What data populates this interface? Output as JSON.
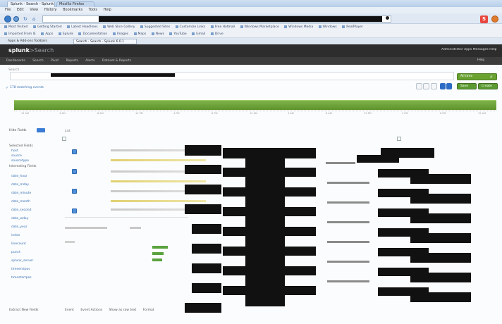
{
  "browser": {
    "tabs": [
      {
        "label": "Splunk - Search - Splunk 6.0.1"
      },
      {
        "label": "Mozilla Firefox"
      }
    ],
    "menu": [
      "File",
      "Edit",
      "View",
      "History",
      "Bookmarks",
      "Tools",
      "Help"
    ],
    "bookmarks_row1": [
      "Most Visited",
      "Getting Started",
      "Latest Headlines",
      "Web Slice Gallery",
      "Suggested Sites",
      "Customize Links",
      "Free Hotmail",
      "Windows Marketplace",
      "Windows Media",
      "Windows",
      "RealPlayer"
    ],
    "bookmarks_row2": [
      "Imported From IE",
      "Apps",
      "Splunk",
      "Documentation",
      "Images",
      "Maps",
      "News",
      "YouTube",
      "Gmail",
      "Drive"
    ],
    "app_tabs": [
      {
        "label": "Apps & Add-ons Toolbars"
      },
      {
        "label": "Search - Search - Splunk 6.0.1"
      }
    ],
    "brand_badge": "S",
    "colors": {
      "chrome": "#cfe0f3",
      "accent": "#3b7dc9"
    }
  },
  "splunk": {
    "logo_main": "splunk",
    "logo_sub": ">Search",
    "account_links": [
      "Administrator",
      "Apps",
      "Messages",
      "Help"
    ],
    "nav": [
      "Dashboards",
      "Search",
      "Pivot",
      "Reports",
      "Alerts",
      "Dataset & Reports"
    ],
    "help_link": "Help",
    "breadcrumb": "Search",
    "search_button": "All time",
    "events_count": "178 matching events",
    "save_button": "Save",
    "create_button": "Create",
    "timeline_ticks": [
      "12 AM",
      "4 AM",
      "8 AM",
      "12 PM",
      "4 PM",
      "8 PM",
      "12 AM",
      "4 AM",
      "8 AM",
      "12 PM",
      "4 PM",
      "8 PM",
      "12 AM"
    ],
    "fields_label": "Hide Fields",
    "results_header": "List",
    "sidebar": {
      "selected_fields_title": "Selected Fields",
      "selected_fields": [
        "host",
        "source",
        "sourcetype"
      ],
      "interesting_fields_title": "Interesting Fields",
      "interesting_fields": [
        "date_hour",
        "date_mday",
        "date_minute",
        "date_month",
        "date_second",
        "date_wday",
        "date_year",
        "index",
        "linecount",
        "punct",
        "splunk_server",
        "timeendpos",
        "timestartpos"
      ],
      "extract_link": "Extract New Fields"
    },
    "bottom_tools": [
      "Event",
      "Event Actions",
      "Show as raw text",
      "Format"
    ],
    "colors": {
      "header": "#2d2d2d",
      "timeline": "#6aa232",
      "link": "#3a73b5"
    }
  }
}
